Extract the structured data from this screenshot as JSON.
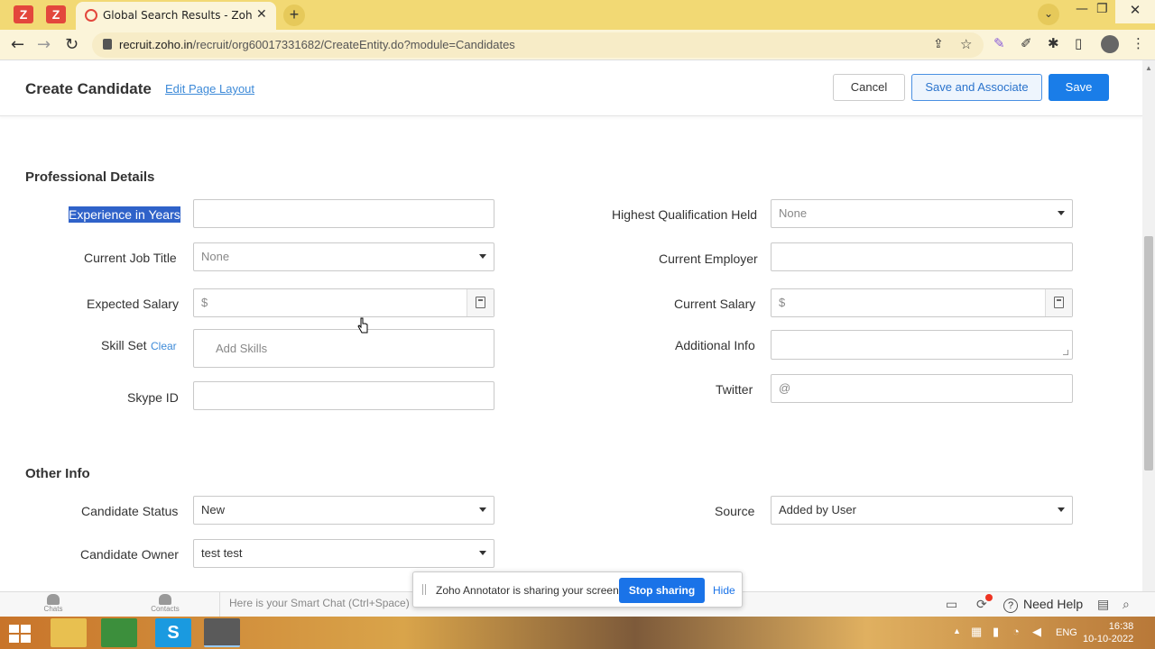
{
  "browser": {
    "pinned_tabs": [
      "Z",
      "Z"
    ],
    "tab_title": "Global Search Results - Zoho Recruit",
    "url_host": "recruit.zoho.in",
    "url_path": "/recruit/org60017331682/CreateEntity.do?module=Candidates"
  },
  "header": {
    "title": "Create Candidate",
    "edit_layout": "Edit Page Layout",
    "cancel": "Cancel",
    "save_associate": "Save and Associate",
    "save": "Save"
  },
  "professional": {
    "section_title": "Professional Details",
    "experience_label": "Experience in Years",
    "experience_value": "",
    "job_title_label": "Current Job Title",
    "job_title_value": "None",
    "expected_salary_label": "Expected Salary",
    "currency_symbol": "$",
    "skill_set_label": "Skill Set",
    "skill_clear": "Clear",
    "skill_placeholder": "Add Skills",
    "skype_label": "Skype ID",
    "qualification_label": "Highest Qualification Held",
    "qualification_value": "None",
    "employer_label": "Current Employer",
    "current_salary_label": "Current Salary",
    "additional_info_label": "Additional Info",
    "twitter_label": "Twitter",
    "twitter_prefix": "@"
  },
  "other": {
    "section_title": "Other Info",
    "status_label": "Candidate Status",
    "status_value": "New",
    "owner_label": "Candidate Owner",
    "owner_value": "test test",
    "source_label": "Source",
    "source_value": "Added by User"
  },
  "bottom_bar": {
    "chats": "Chats",
    "contacts": "Contacts",
    "smart_chat": "Here is your Smart Chat (Ctrl+Space)",
    "need_help": "Need Help"
  },
  "share_bar": {
    "message": "Zoho Annotator is sharing your screen.",
    "stop": "Stop sharing",
    "hide": "Hide"
  },
  "taskbar": {
    "language": "ENG",
    "time": "16:38",
    "date": "10-10-2022"
  },
  "colors": {
    "accent_blue": "#1a7de8",
    "link_blue": "#3d8ad8",
    "tab_strip": "#f2d974"
  }
}
